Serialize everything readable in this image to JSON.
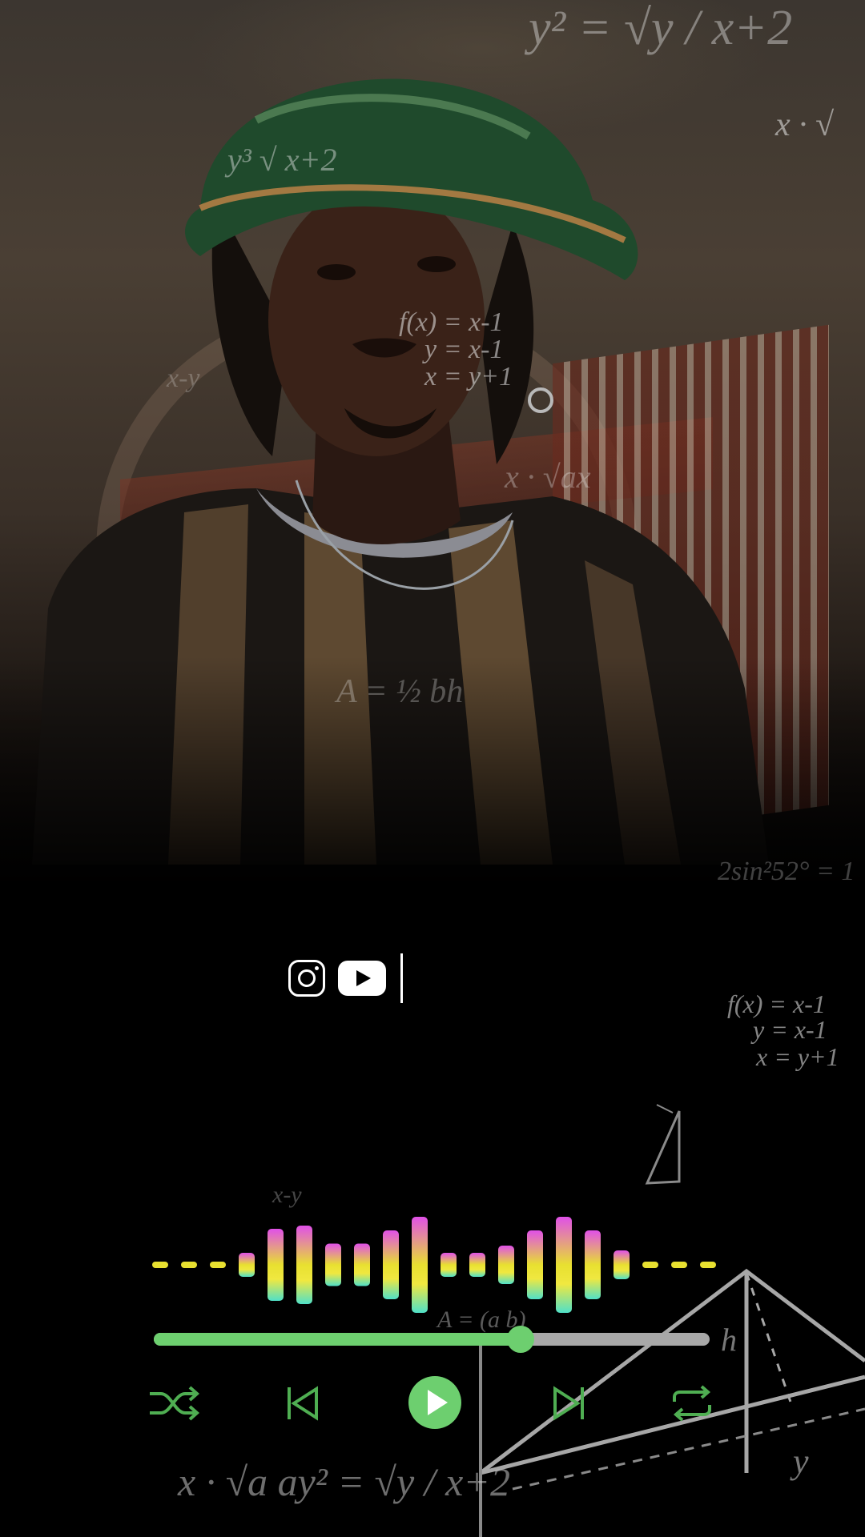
{
  "formulas": [
    "y² = √y / x+2",
    "x · √",
    "y³ √ x+2",
    "f(x) = x-1",
    "y = x-1",
    "x = y+1",
    "x-y",
    "x · √ax",
    "A = ½ bh",
    "2sin²52° = 1",
    "f(x) = x-1",
    "y = x-1",
    "x = y+1",
    "x-y",
    "A = (a b)",
    "h",
    "y",
    "x · √a  ay² = √y / x+2"
  ],
  "social": {
    "instagram": "instagram-icon",
    "youtube": "youtube-icon"
  },
  "player": {
    "progress": 0.66,
    "accent_color": "#6dcf6f",
    "track_color": "#a8a8a8",
    "visualizer_levels": [
      0.06,
      0.06,
      0.06,
      0.25,
      0.75,
      0.82,
      0.44,
      0.44,
      0.72,
      1.0,
      0.25,
      0.25,
      0.4,
      0.72,
      1.0,
      0.72,
      0.3,
      0.06,
      0.06,
      0.06
    ],
    "controls": [
      "shuffle-icon",
      "previous-icon",
      "play-icon",
      "next-icon",
      "repeat-icon"
    ]
  }
}
